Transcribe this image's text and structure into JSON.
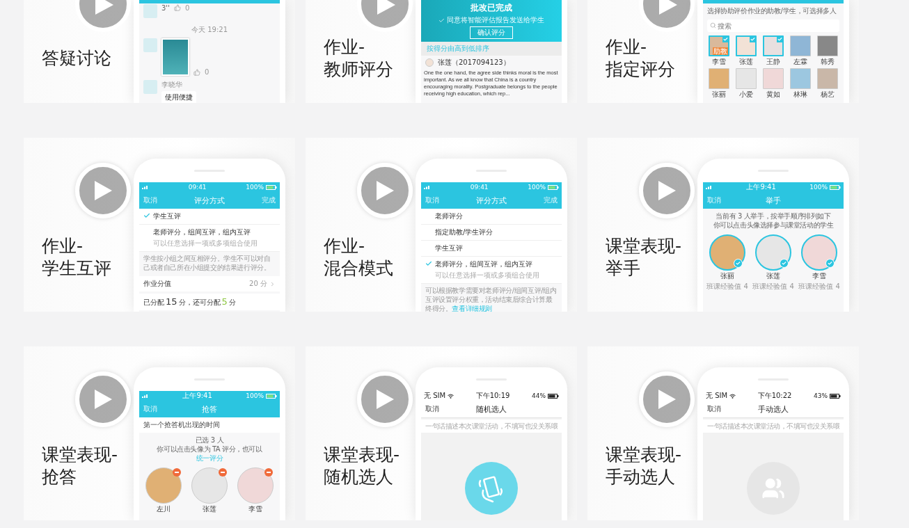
{
  "cards": [
    {
      "title": "答疑讨论",
      "phone": {
        "cropped": true,
        "kind": "teal",
        "items": [
          {
            "kind": "voice",
            "duration": "3''",
            "likes": "0"
          },
          {
            "kind": "time",
            "text": "今天 19:21"
          },
          {
            "kind": "image_post",
            "likes": "0"
          },
          {
            "kind": "message",
            "name": "李晓华",
            "text": "使用便捷"
          }
        ]
      }
    },
    {
      "title": "作业-\n教师评分",
      "phone": {
        "cropped": true,
        "kind": "teal",
        "items": [
          {
            "kind": "banner",
            "title": "批改已完成",
            "text": "同意将智能评估报告发送给学生",
            "button": "确认评分"
          },
          {
            "kind": "sort_bar",
            "text": "按得分由高到低排序"
          },
          {
            "kind": "author",
            "name": "张莲（2017094123）"
          },
          {
            "kind": "paragraph",
            "text": "One the one hand, the agree side thinks moral is the most important. As we all know that China is a country encouraging morality. Postgraduate belongs to the people receiving high education, which rep..."
          }
        ]
      }
    },
    {
      "title": "作业-\n指定评分",
      "phone": {
        "cropped": true,
        "kind": "teal",
        "items": [
          {
            "kind": "hint",
            "lines": [
              "选择协助评价作业的助教/学生，可选择多人"
            ]
          },
          {
            "kind": "search",
            "placeholder": "搜索"
          },
          {
            "kind": "avatar_grid",
            "people": [
              {
                "name": "李雪",
                "checked": true,
                "badge": "助教"
              },
              {
                "name": "张莲",
                "checked": true
              },
              {
                "name": "王静",
                "checked": true
              },
              {
                "name": "左霖",
                "checked": false
              },
              {
                "name": "韩秀",
                "checked": false
              },
              {
                "name": "张丽",
                "checked": false
              },
              {
                "name": "小爱",
                "checked": false
              },
              {
                "name": "黄如",
                "checked": false
              },
              {
                "name": "林琳",
                "checked": false
              },
              {
                "name": "杨艺",
                "checked": false
              }
            ]
          }
        ]
      }
    },
    {
      "title": "作业-\n学生互评",
      "phone": {
        "cropped": false,
        "kind": "teal",
        "status": {
          "time": "09:41",
          "battery": "100%"
        },
        "nav": {
          "left": "取消",
          "title": "评分方式",
          "right": "完成"
        },
        "items": [
          {
            "kind": "option",
            "label": "学生互评",
            "checked": true
          },
          {
            "kind": "option",
            "label": "老师评分，组间互评，组内互评",
            "sub": "可以任意选择一项或多项组合使用",
            "checked": false
          },
          {
            "kind": "note",
            "text": "学生按小组之间互相评分。学生不可以对自己或者自己所在小组提交的结果进行评分。"
          },
          {
            "kind": "value_row",
            "label": "作业分值",
            "value": "20 分"
          },
          {
            "kind": "allot",
            "prefix": "已分配",
            "assigned": "15",
            "middle": "分，还可分配",
            "remaining": "5",
            "suffix": "分"
          }
        ]
      }
    },
    {
      "title": "作业-\n混合模式",
      "phone": {
        "cropped": false,
        "kind": "teal",
        "status": {
          "time": "09:41",
          "battery": "100%"
        },
        "nav": {
          "left": "取消",
          "title": "评分方式",
          "right": "完成"
        },
        "items": [
          {
            "kind": "option",
            "label": "老师评分",
            "checked": false
          },
          {
            "kind": "option",
            "label": "指定助教/学生评分",
            "checked": false
          },
          {
            "kind": "option",
            "label": "学生互评",
            "checked": false
          },
          {
            "kind": "option",
            "label": "老师评分，组间互评，组内互评",
            "sub": "可以任意选择一项或多项组合使用",
            "checked": true
          },
          {
            "kind": "note",
            "text": "可以根据教学需要对老师评分/组间互评/组内互评设置评分权重，活动结束后综合计算最终得分。",
            "link": "查看详细规则"
          }
        ]
      }
    },
    {
      "title": "课堂表现-\n举手",
      "phone": {
        "cropped": false,
        "kind": "teal",
        "status": {
          "time": "上午9:41",
          "battery": "100%"
        },
        "nav": {
          "left": "取消",
          "title": "举手"
        },
        "items": [
          {
            "kind": "hint",
            "lines": [
              "当前有 3 人举手，按举手顺序排列如下",
              "你可以点击头像选择参与课堂活动的学生"
            ]
          },
          {
            "kind": "avatar_row",
            "people": [
              {
                "name": "张丽",
                "sub": "班课经验值 4",
                "checked": true,
                "removable": false
              },
              {
                "name": "张莲",
                "sub": "班课经验值 4",
                "checked": true,
                "removable": false
              },
              {
                "name": "李雪",
                "sub": "班课经验值 4",
                "checked": true,
                "removable": false
              }
            ]
          }
        ]
      }
    },
    {
      "title": "课堂表现-\n抢答",
      "phone": {
        "cropped": false,
        "kind": "teal",
        "status": {
          "time": "上午9:41",
          "battery": "100%"
        },
        "nav": {
          "left": "取消",
          "title": "抢答"
        },
        "items": [
          {
            "kind": "field_row",
            "text": "第一个抢答机出现的时间"
          },
          {
            "kind": "summary",
            "count": "已选 3 人",
            "text": "你可以点击头像为 TA 评分，也可以",
            "link": "统一评分"
          },
          {
            "kind": "avatar_row",
            "people": [
              {
                "name": "左川",
                "checked": false,
                "removable": true
              },
              {
                "name": "张莲",
                "checked": false,
                "removable": true
              },
              {
                "name": "李雪",
                "checked": false,
                "removable": true
              }
            ]
          }
        ]
      }
    },
    {
      "title": "课堂表现-\n随机选人",
      "phone": {
        "cropped": false,
        "kind": "white",
        "status": {
          "carrier": "无 SIM",
          "time": "下午10:19",
          "battery": "44%"
        },
        "nav": {
          "left": "取消",
          "title": "随机选人"
        },
        "items": [
          {
            "kind": "input",
            "placeholder": "一句话描述本次课堂活动，不填写也没关系哦"
          },
          {
            "kind": "shake_button"
          }
        ]
      }
    },
    {
      "title": "课堂表现-\n手动选人",
      "phone": {
        "cropped": false,
        "kind": "white",
        "status": {
          "carrier": "无 SIM",
          "time": "下午10:22",
          "battery": "43%"
        },
        "nav": {
          "left": "取消",
          "title": "手动选人"
        },
        "items": [
          {
            "kind": "input",
            "placeholder": "一句话描述本次课堂活动，不填写也没关系哦"
          },
          {
            "kind": "people_button"
          }
        ]
      }
    }
  ]
}
